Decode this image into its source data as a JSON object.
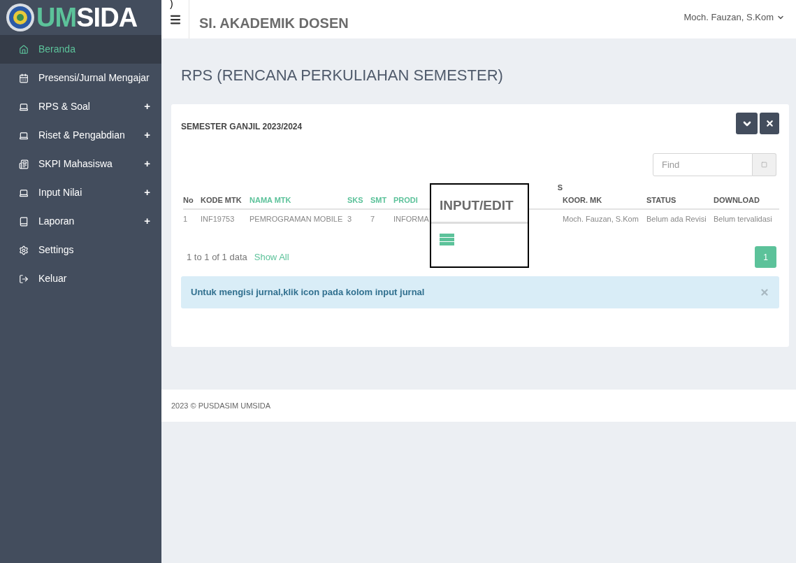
{
  "top_fragment": ")",
  "brand": {
    "accent": "UM",
    "rest": "SIDA"
  },
  "sidebar": {
    "items": [
      {
        "label": "Beranda",
        "selected": true
      },
      {
        "label": "Presensi/Jurnal Mengajar",
        "selected": false
      },
      {
        "label": "RPS & Soal",
        "toggle": "+",
        "selected": false
      },
      {
        "label": "Riset & Pengabdian",
        "toggle": "+",
        "selected": false
      },
      {
        "label": "SKPI Mahasiswa",
        "toggle": "+",
        "selected": false
      },
      {
        "label": "Input Nilai",
        "toggle": "+",
        "selected": false
      },
      {
        "label": "Laporan",
        "toggle": "+",
        "selected": false
      },
      {
        "label": "Settings",
        "selected": false
      },
      {
        "label": "Keluar",
        "selected": false
      }
    ]
  },
  "header": {
    "title": "SI. AKADEMIK DOSEN",
    "user": "Moch. Fauzan, S.Kom"
  },
  "page_title": "RPS (RENCANA PERKULIAHAN SEMESTER)",
  "panel": {
    "title": "SEMESTER GANJIL 2023/2024",
    "search": {
      "placeholder": "Find"
    },
    "table": {
      "columns": [
        {
          "label": "No",
          "kind": "data",
          "highlighted": false
        },
        {
          "label": "KODE MTK",
          "kind": "data",
          "highlighted": false
        },
        {
          "label": "NAMA MTK",
          "kind": "data",
          "highlighted": true
        },
        {
          "label": "SKS",
          "kind": "data",
          "highlighted": true
        },
        {
          "label": "SMT",
          "kind": "data",
          "highlighted": true
        },
        {
          "label": "PRODI",
          "kind": "data",
          "highlighted": true
        },
        {
          "label": "S",
          "kind": "covered"
        },
        {
          "label": "KOOR. MK",
          "kind": "data",
          "highlighted": false
        },
        {
          "label": "STATUS",
          "kind": "data",
          "highlighted": false
        },
        {
          "label": "DOWNLOAD",
          "kind": "data",
          "highlighted": false
        }
      ],
      "rows": [
        [
          "1",
          "INF19753",
          "PEMROGRAMAN MOBILE",
          "3",
          "7",
          "INFORMA",
          "",
          "Moch. Fauzan, S.Kom",
          "Belum ada Revisi",
          "Belum tervalidasi"
        ]
      ]
    },
    "summary": "1 to 1 of 1 data",
    "show_all": "Show All",
    "pages": [
      {
        "label": "1",
        "selected": true
      }
    ],
    "alert": "Untuk mengisi jurnal,klik icon pada kolom input jurnal"
  },
  "callout": {
    "title": "INPUT/EDIT"
  },
  "footer": "2023 © PUSDASIM UMSIDA"
}
